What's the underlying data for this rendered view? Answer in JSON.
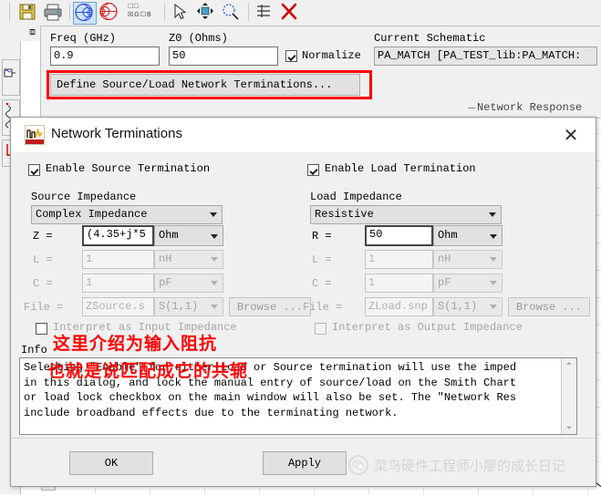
{
  "toolbar": {
    "icons": [
      {
        "name": "save-icon",
        "glyph": "save"
      },
      {
        "name": "print-icon",
        "glyph": "print"
      },
      {
        "name": "smith-chart-blue-icon",
        "glyph": "smith-blue"
      },
      {
        "name": "smith-chart-red-icon",
        "glyph": "smith-red"
      },
      {
        "name": "select-arrow-icon",
        "glyph": "arrow"
      },
      {
        "name": "move-icon",
        "glyph": "move"
      },
      {
        "name": "zoom-region-icon",
        "glyph": "zoom"
      },
      {
        "name": "table-icon",
        "glyph": "table"
      },
      {
        "name": "delete-red-x-icon",
        "glyph": "xmark"
      }
    ],
    "gb_checkboxes": [
      {
        "label": "G",
        "checked": true
      },
      {
        "label": "B",
        "checked": false
      }
    ]
  },
  "panel": {
    "freq_label": "Freq (GHz)",
    "freq_value": "0.9",
    "z0_label": "Z0 (Ohms)",
    "z0_value": "50",
    "normalize_label": "Normalize",
    "normalize_checked": true,
    "define_button": "Define Source/Load Network Terminations...",
    "current_schematic_label": "Current Schematic",
    "current_schematic_value": "PA_MATCH [PA_TEST_lib:PA_MATCH:",
    "network_response_label": "Network Response",
    "highlight_color": "#ff0000"
  },
  "dialog": {
    "title": "Network Terminations",
    "close_label": "✕",
    "source": {
      "enable_label": "Enable Source Termination",
      "enable_checked": true,
      "group_label": "Source Impedance",
      "type_value": "Complex Impedance",
      "z_label": "Z =",
      "z_value": "(4.35+j*5",
      "z_unit": "Ohm",
      "l_label": "L =",
      "l_value": "1",
      "l_unit": "nH",
      "c_label": "C =",
      "c_value": "1",
      "c_unit": "pF",
      "file_label": "File =",
      "file_value": "ZSource.s",
      "file_port": "S(1,1)",
      "browse_label": "Browse ...",
      "interpret_label": "Interpret as Input Impedance",
      "interpret_checked": false
    },
    "load": {
      "enable_label": "Enable Load Termination",
      "enable_checked": true,
      "group_label": "Load Impedance",
      "type_value": "Resistive",
      "r_label": "R =",
      "r_value": "50",
      "r_unit": "Ohm",
      "l_label": "L =",
      "l_value": "1",
      "l_unit": "nH",
      "c_label": "C =",
      "c_value": "1",
      "c_unit": "pF",
      "file_label": "File =",
      "file_value": "ZLoad.snp",
      "file_port": "S(1,1)",
      "browse_label": "Browse ...",
      "interpret_label": "Interpret as Output Impedance",
      "interpret_checked": false
    },
    "info": {
      "label": "Info",
      "text": "Selecting \"Enable\" for either Load or Source termination will use the imped\nin this dialog, and lock the manual entry of source/load on the Smith Chart\nor load lock checkbox on the main window will also be set. The \"Network Res\ninclude broadband effects due to the terminating network.",
      "scroll_up": "⌃",
      "scroll_down": "⌄"
    },
    "footer": {
      "ok_label": "OK",
      "apply_label": "Apply"
    }
  },
  "annotations": {
    "line1": "这里介绍为输入阻抗",
    "line2": "也就是说匹配成它的共轭",
    "color": "#ff0000"
  },
  "watermark": {
    "text": "菜鸟硬件工程师小廖的成长日记",
    "icon": "wechat-icon"
  }
}
